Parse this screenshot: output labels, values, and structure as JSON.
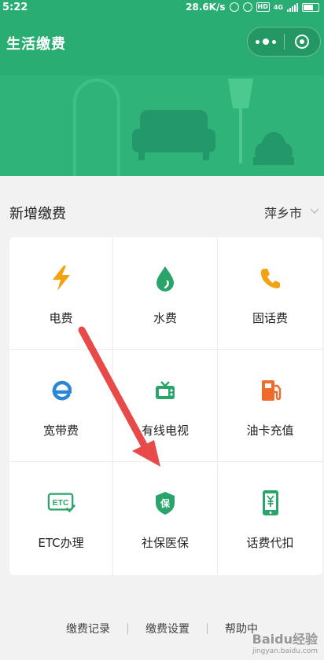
{
  "status_bar": {
    "time": "5:22",
    "speed": "28.6K/s",
    "network": "4G"
  },
  "header": {
    "title": "生活缴费"
  },
  "colors": {
    "brand_green": "#29ad72",
    "arrow_red": "#e84a4a",
    "icon_green": "#2aa46a",
    "icon_orange": "#f3a312",
    "icon_blue": "#2b86d4",
    "icon_red_orange": "#f06a2a"
  },
  "section": {
    "label": "新增缴费",
    "city": "萍乡市"
  },
  "services": [
    {
      "label": "电费",
      "icon": "lightning-icon"
    },
    {
      "label": "水费",
      "icon": "water-drop-icon"
    },
    {
      "label": "固话费",
      "icon": "phone-icon"
    },
    {
      "label": "宽带费",
      "icon": "browser-e-icon"
    },
    {
      "label": "有线电视",
      "icon": "tv-icon"
    },
    {
      "label": "油卡充值",
      "icon": "gas-pump-icon"
    },
    {
      "label": "ETC办理",
      "icon": "etc-icon"
    },
    {
      "label": "社保医保",
      "icon": "shield-bao-icon"
    },
    {
      "label": "话费代扣",
      "icon": "mobile-yuan-icon"
    }
  ],
  "etc_icon_text": "ETC",
  "bao_icon_text": "保",
  "footer": {
    "records": "缴费记录",
    "settings": "缴费设置",
    "help": "帮助中"
  },
  "watermark": {
    "brand": "Baidu经验",
    "url": "jingyan.baidu.com"
  }
}
